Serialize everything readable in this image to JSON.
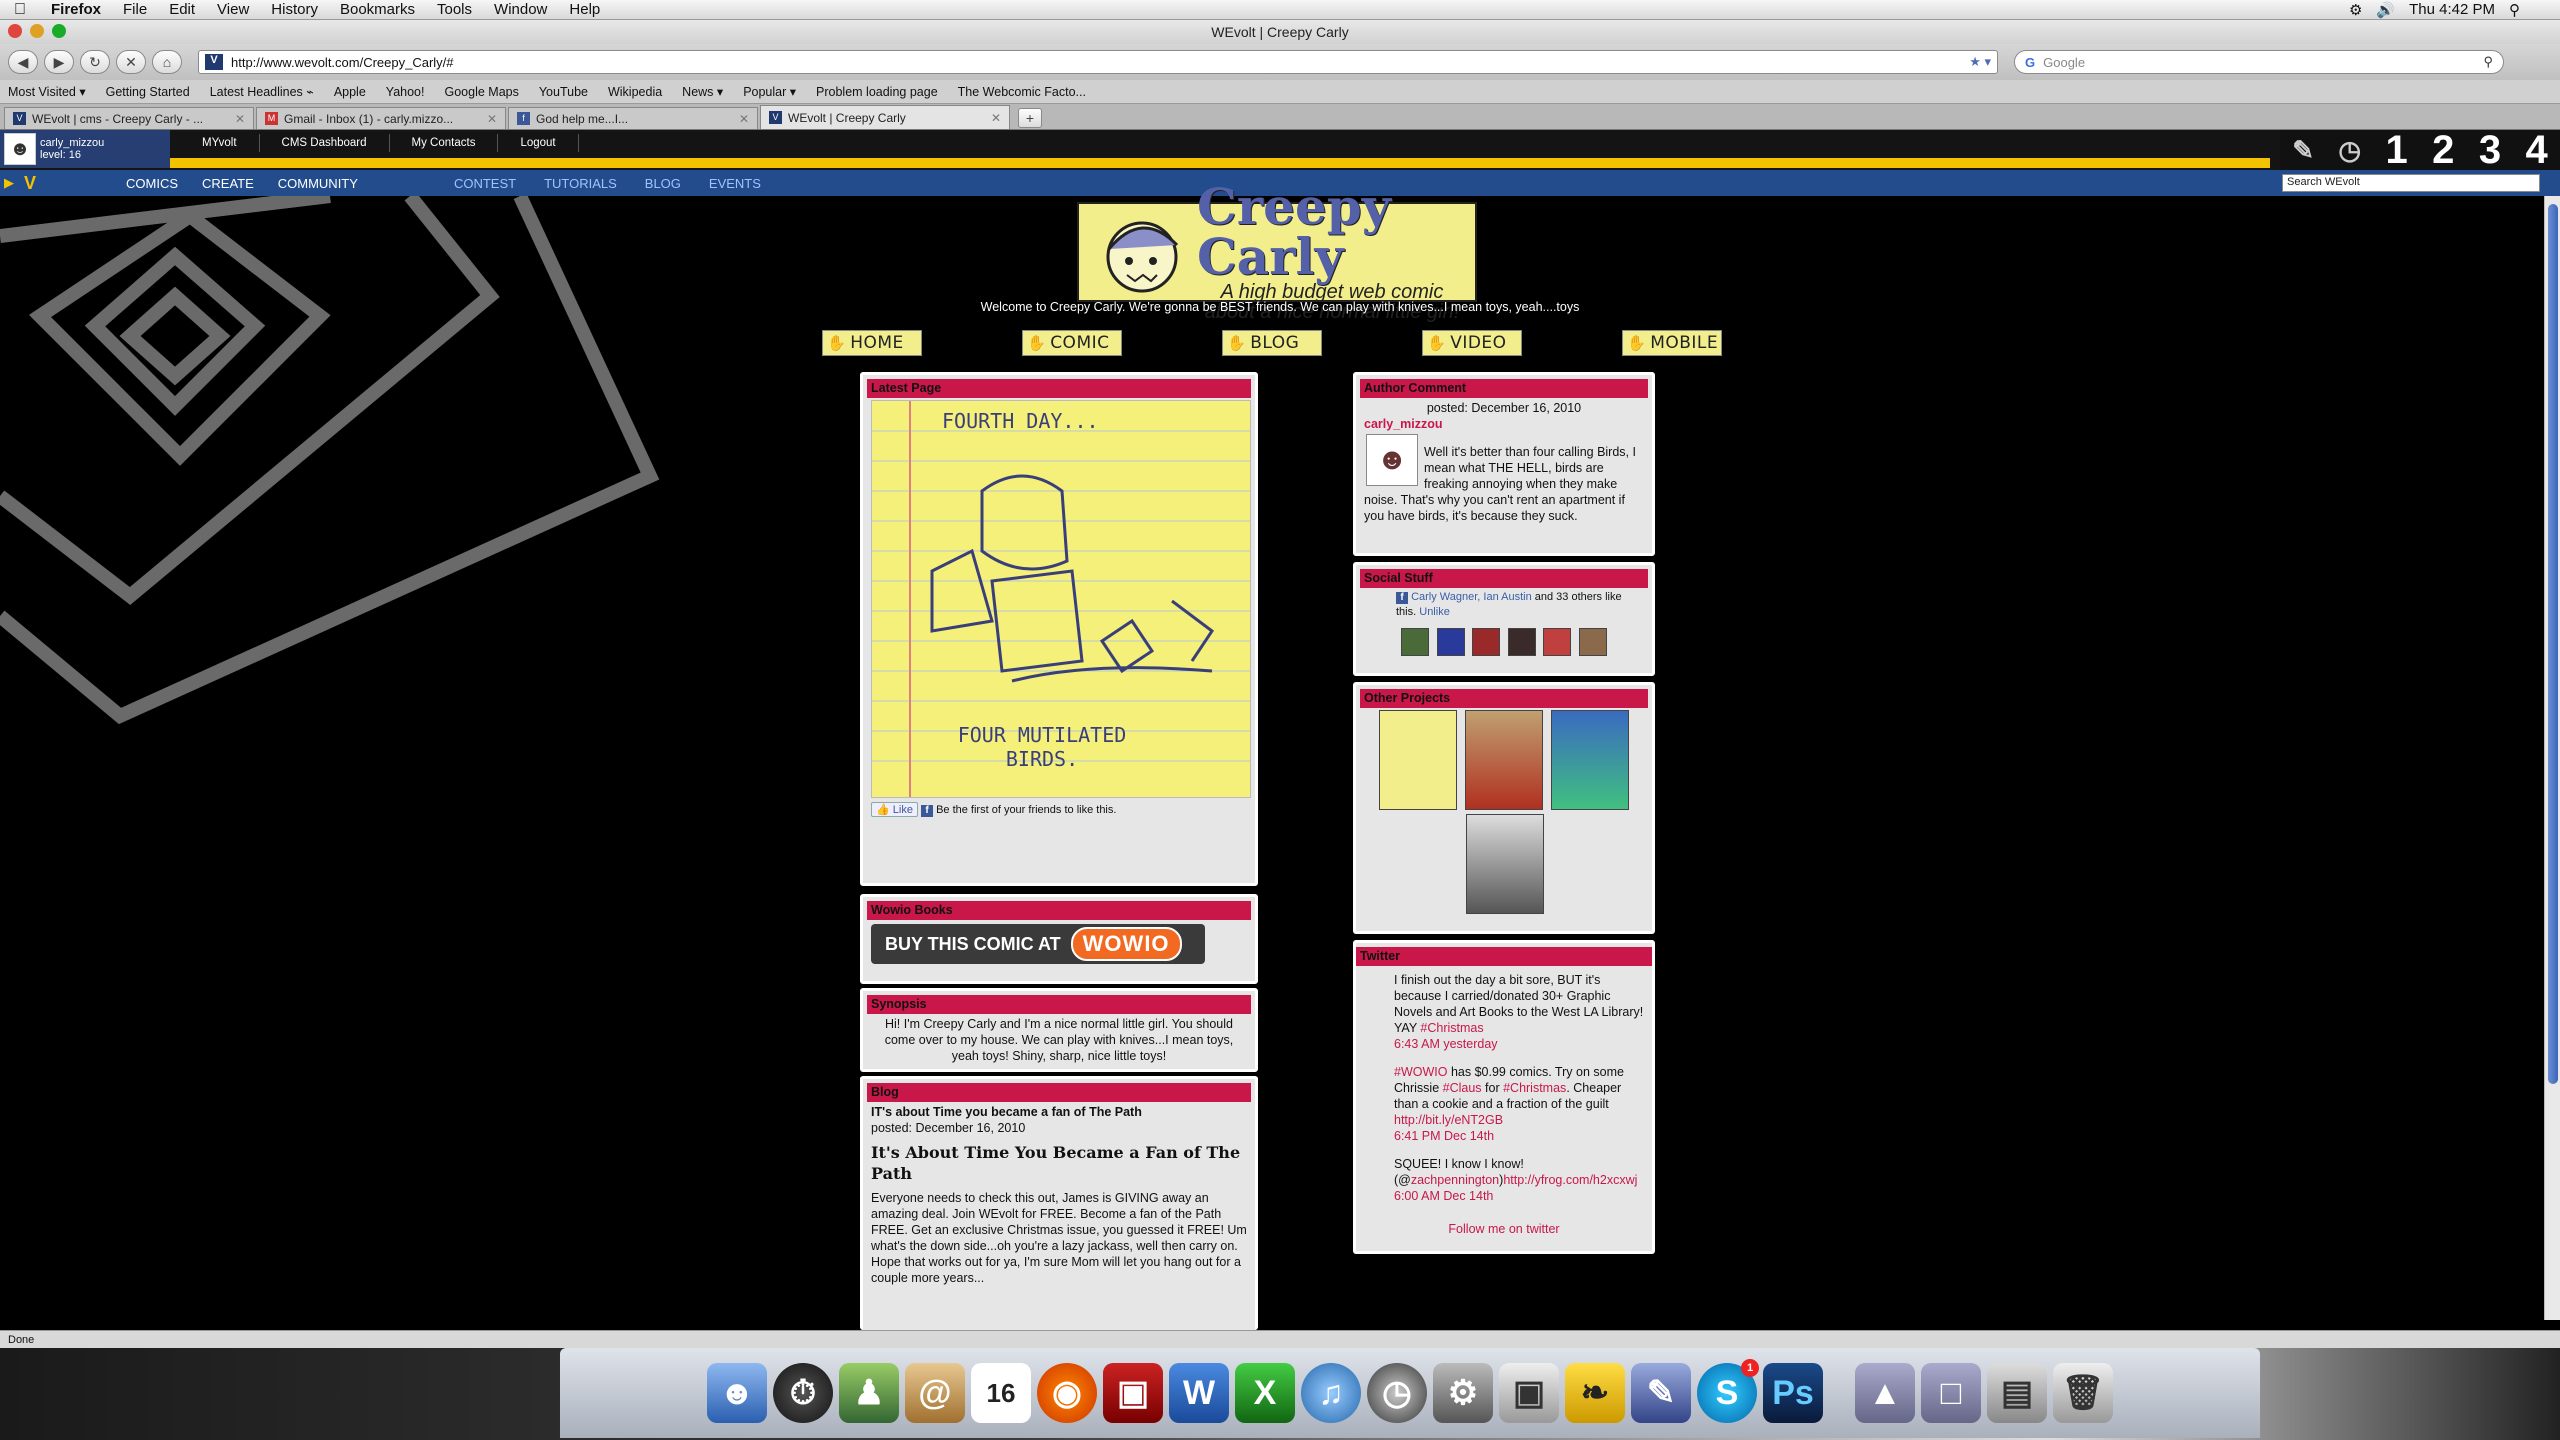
{
  "menubar": {
    "app": "Firefox",
    "items": [
      "File",
      "Edit",
      "View",
      "History",
      "Bookmarks",
      "Tools",
      "Window",
      "Help"
    ],
    "clock": "Thu 4:42 PM"
  },
  "window": {
    "title": "WEvolt | Creepy Carly"
  },
  "toolbar": {
    "url": "http://www.wevolt.com/Creepy_Carly/#",
    "search_placeholder": "Google"
  },
  "bookmarks": [
    "Most Visited ▾",
    "Getting Started",
    "Latest Headlines ⌁",
    "Apple",
    "Yahoo!",
    "Google Maps",
    "YouTube",
    "Wikipedia",
    "News ▾",
    "Popular ▾",
    "Problem loading page",
    "The Webcomic Facto..."
  ],
  "tabs": [
    {
      "label": "WEvolt | cms - Creepy Carly - ..."
    },
    {
      "label": "Gmail - Inbox (1) - carly.mizzo..."
    },
    {
      "label": "God help me...I..."
    },
    {
      "label": "WEvolt | Creepy Carly"
    }
  ],
  "site": {
    "user": {
      "name": "carly_mizzou",
      "level": "level: 16"
    },
    "topnav": [
      "MYvolt",
      "CMS Dashboard",
      "My Contacts",
      "Logout"
    ],
    "toolnumbers": [
      "1",
      "2",
      "3",
      "4"
    ],
    "mainnav": [
      "COMICS",
      "CREATE",
      "COMMUNITY"
    ],
    "subnav": [
      "CONTEST",
      "TUTORIALS",
      "BLOG",
      "EVENTS"
    ],
    "search_value": "Search WEvolt"
  },
  "comic": {
    "title": "Creepy Carly",
    "subtitle": "A high budget web comic about a nice normal little girl!",
    "welcome": "Welcome to Creepy Carly. We're gonna be BEST friends. We can play with knives...I mean toys, yeah....toys",
    "nav": [
      "HOME",
      "COMIC",
      "BLOG",
      "VIDEO",
      "MOBILE"
    ]
  },
  "latest": {
    "head": "Latest Page",
    "page_top": "FOURTH DAY...",
    "page_bottom": "FOUR MUTILATED BIRDS.",
    "like": "Like",
    "like_text": "Be the first of your friends to like this."
  },
  "wowio": {
    "head": "Wowio Books",
    "button": "BUY THIS COMIC AT",
    "brand": "WOWIO"
  },
  "synopsis": {
    "head": "Synopsis",
    "text": "Hi! I'm Creepy Carly and I'm a nice normal little girl. You should come over to my house. We can play with knives...I mean toys, yeah toys! Shiny, sharp, nice little toys!"
  },
  "blog": {
    "head": "Blog",
    "post_small_title": "IT's about Time you became a fan of The Path",
    "posted": "posted: December 16, 2010",
    "post_title": "It's About Time You Became a Fan of The Path",
    "body": "Everyone needs to check this out, James is GIVING away an amazing deal. Join WEvolt for FREE. Become a fan of the Path FREE. Get an exclusive Christmas issue, you guessed it FREE! Um what's the down side...oh you're a lazy jackass, well then carry on. Hope that works out for ya, I'm sure Mom will let you hang out for a couple more years..."
  },
  "author": {
    "head": "Author Comment",
    "posted": "posted: December 16, 2010",
    "user": "carly_mizzou",
    "text": "Well it's better than four calling Birds, I mean what THE HELL, birds are freaking annoying when they make noise. That's why you can't rent an apartment if you have birds, it's because they suck."
  },
  "social": {
    "head": "Social Stuff",
    "names": "Carly Wagner, Ian Austin",
    "rest": " and 33 others like this.",
    "unlike": "Unlike"
  },
  "projects": {
    "head": "Other Projects"
  },
  "twitter": {
    "head": "Twitter",
    "t1": "I finish out the day a bit sore, BUT it's because I carried/donated 30+ Graphic Novels and Art Books to the West LA Library! YAY ",
    "t1_tag": "#Christmas",
    "t1_time": "6:43 AM yesterday",
    "t2_tag1": "#WOWIO",
    "t2a": " has $0.99 comics. Try on some Chrissie ",
    "t2_tag2": "#Claus",
    "t2b": " for ",
    "t2_tag3": "#Christmas",
    "t2c": ". Cheaper than a cookie and a fraction of the guilt ",
    "t2_link": "http://bit.ly/eNT2GB",
    "t2_time": "6:41 PM Dec 14th",
    "t3a": "SQUEE! I know I know! (@",
    "t3_user": "zachpennington",
    "t3b": ")",
    "t3_link": "http://yfrog.com/h2xcxwj",
    "t3_time": "6:00 AM Dec 14th",
    "follow": "Follow me on twitter"
  },
  "status": "Done",
  "colors": {
    "accent_red": "#c9174a",
    "nav_blue": "#234c8c",
    "yellow": "#f4c300",
    "panel_bg": "#e6e6e6"
  }
}
